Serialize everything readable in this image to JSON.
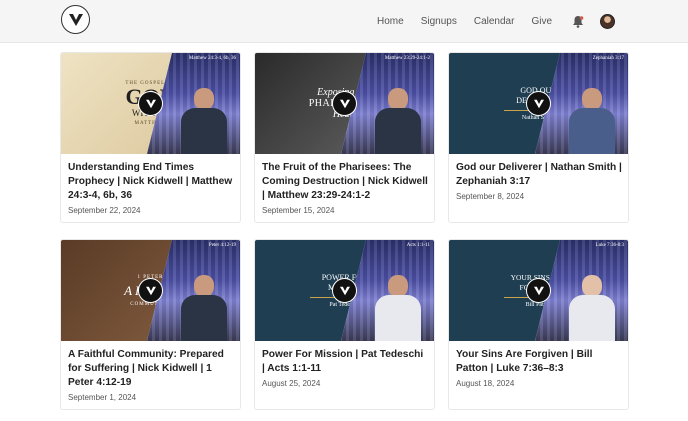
{
  "header": {
    "logo_icon": "church-v-logo-icon",
    "nav": [
      "Home",
      "Signups",
      "Calendar",
      "Give"
    ],
    "icons": [
      "bell-icon",
      "user-avatar"
    ]
  },
  "sermons": [
    {
      "thumb_heading": "GOD",
      "thumb_sub": "WITH US",
      "thumb_top": "THE GOSPEL OF",
      "thumb_bottom": "MATTHEW",
      "reference": "Matthew 24:3-4, 6b, 36",
      "title": "Understanding End Times Prophecy | Nick Kidwell | Matthew 24:3-4, 6b, 36",
      "date": "September 22, 2024"
    },
    {
      "thumb_heading": "Exposing The",
      "thumb_sub": "PHARISAICAL",
      "thumb_bottom": "Heart",
      "reference": "Matthew 23:29-24:1-2",
      "title": "The Fruit of the Pharisees: The Coming Destruction | Nick Kidwell | Matthew 23:29-24:1-2",
      "date": "September 15, 2024"
    },
    {
      "thumb_heading": "GOD OUR DELIVERER",
      "thumb_sub": "Nathan Smith",
      "reference": "Zephaniah 3:17",
      "title": "God our Deliverer | Nathan Smith | Zephaniah 3:17",
      "date": "September 8, 2024"
    },
    {
      "thumb_heading": "A Faithful",
      "thumb_top": "1 PETER",
      "thumb_bottom": "COMMUNITY",
      "reference": "Peter 4:12-19",
      "title": "A Faithful Community: Prepared for Suffering | Nick Kidwell | 1 Peter 4:12-19",
      "date": "September 1, 2024"
    },
    {
      "thumb_heading": "POWER FOR MISSION",
      "thumb_sub": "Pat Tedeschi",
      "reference": "Acts 1:1-11",
      "title": "Power For Mission | Pat Tedeschi | Acts 1:1-11",
      "date": "August 25, 2024"
    },
    {
      "thumb_heading": "YOUR SINS ARE FORGIVEN",
      "thumb_sub": "Bill Patton",
      "reference": "Luke 7:36-8:3",
      "title": "Your Sins Are Forgiven | Bill Patton | Luke 7:36–8:3",
      "date": "August 18, 2024"
    }
  ]
}
